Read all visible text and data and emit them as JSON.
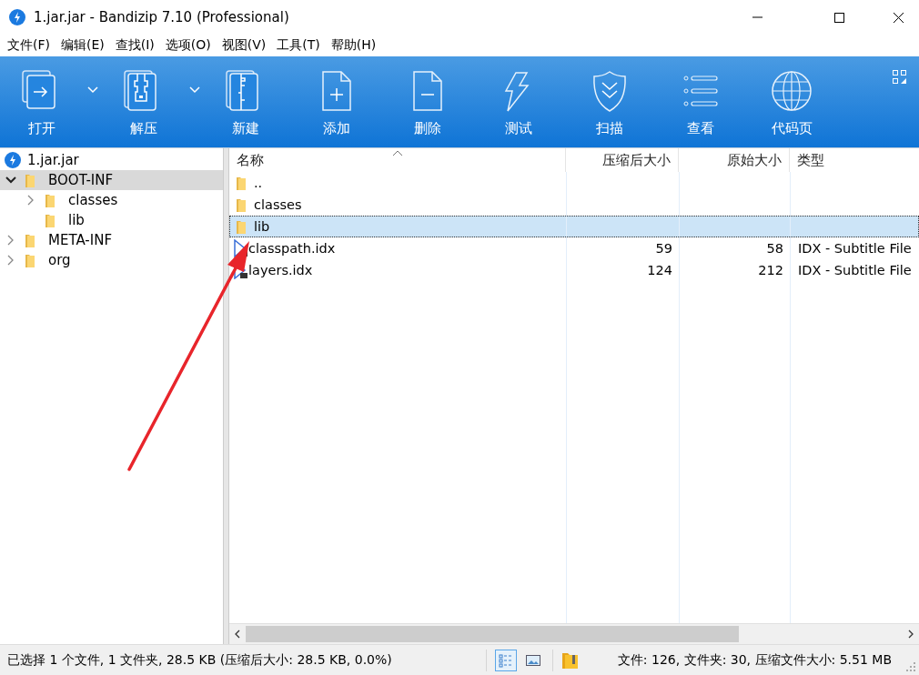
{
  "window": {
    "title": "1.jar.jar - Bandizip 7.10 (Professional)"
  },
  "menu": [
    "文件(F)",
    "编辑(E)",
    "查找(I)",
    "选项(O)",
    "视图(V)",
    "工具(T)",
    "帮助(H)"
  ],
  "toolbar": [
    {
      "kind": "open",
      "label": "打开",
      "dropdown": true
    },
    {
      "kind": "extract",
      "label": "解压",
      "dropdown": true
    },
    {
      "kind": "new",
      "label": "新建",
      "dropdown": false
    },
    {
      "kind": "add",
      "label": "添加",
      "dropdown": false
    },
    {
      "kind": "delete",
      "label": "删除",
      "dropdown": false
    },
    {
      "kind": "test",
      "label": "测试",
      "dropdown": false
    },
    {
      "kind": "scan",
      "label": "扫描",
      "dropdown": false
    },
    {
      "kind": "view",
      "label": "查看",
      "dropdown": false
    },
    {
      "kind": "codepage",
      "label": "代码页",
      "dropdown": false
    }
  ],
  "tree": {
    "root": "1.jar.jar",
    "items": [
      {
        "label": "BOOT-INF",
        "expandable": true,
        "expanded": true,
        "selected": true,
        "children": [
          {
            "label": "classes",
            "expandable": true,
            "expanded": false,
            "selected": false
          },
          {
            "label": "lib",
            "expandable": false,
            "selected": false
          }
        ]
      },
      {
        "label": "META-INF",
        "expandable": true,
        "expanded": false,
        "selected": false
      },
      {
        "label": "org",
        "expandable": true,
        "expanded": false,
        "selected": false
      }
    ]
  },
  "file_list": {
    "columns": [
      {
        "label": "名称",
        "sorted": true
      },
      {
        "label": "压缩后大小",
        "sorted": false
      },
      {
        "label": "原始大小",
        "sorted": false
      },
      {
        "label": "类型",
        "sorted": false
      }
    ],
    "rows": [
      {
        "kind": "folder",
        "name": "..",
        "selected": false
      },
      {
        "kind": "folder",
        "name": "classes",
        "selected": false
      },
      {
        "kind": "folder",
        "name": "lib",
        "selected": true
      },
      {
        "kind": "file",
        "name": "classpath.idx",
        "packed": "59",
        "original": "58",
        "type": "IDX - Subtitle File",
        "selected": false
      },
      {
        "kind": "file",
        "name": "layers.idx",
        "packed": "124",
        "original": "212",
        "type": "IDX - Subtitle File",
        "selected": false
      }
    ]
  },
  "status_bar": {
    "selection": "已选择 1 个文件, 1 文件夹, 28.5 KB (压缩后大小: 28.5 KB, 0.0%)",
    "views": [
      {
        "kind": "details",
        "selected": true
      },
      {
        "kind": "thumbnails",
        "selected": false
      }
    ],
    "summary": "文件: 126, 文件夹: 30, 压缩文件大小: 5.51 MB"
  }
}
